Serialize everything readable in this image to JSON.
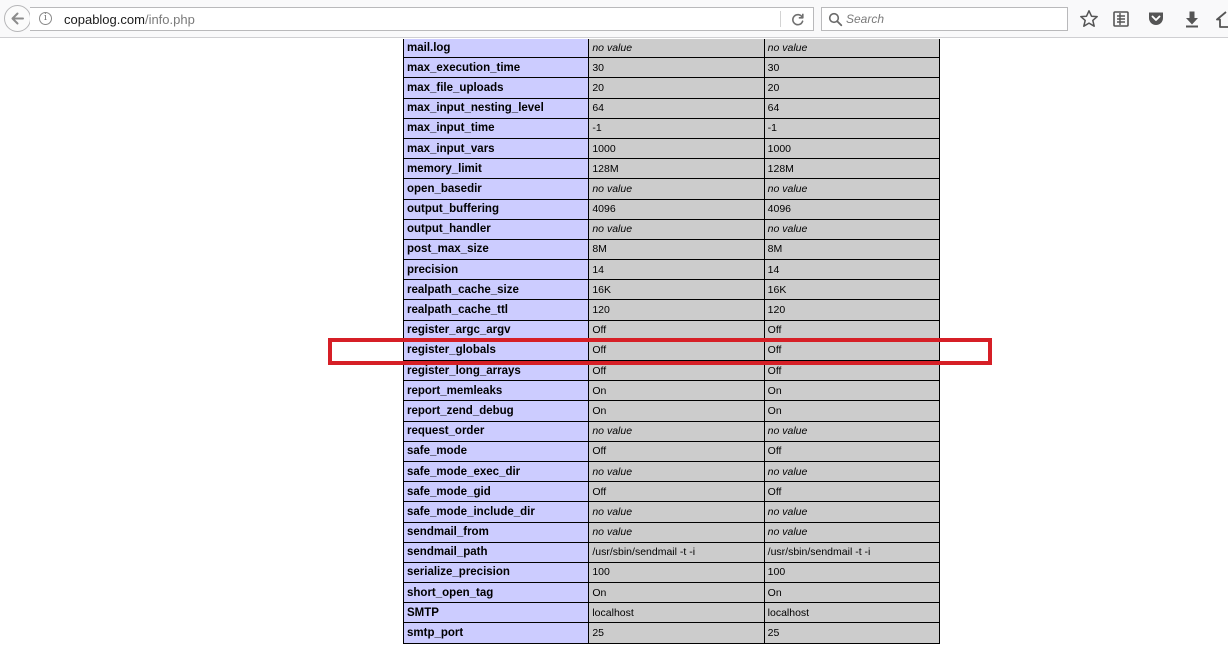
{
  "browser": {
    "url_domain": "copablog.com",
    "url_path": "/info.php",
    "search_placeholder": "Search"
  },
  "accent": {
    "highlight_border": "#d61f26"
  },
  "table": {
    "rows": [
      {
        "directive": "mail.log",
        "local": "no value",
        "master": "no value"
      },
      {
        "directive": "max_execution_time",
        "local": "30",
        "master": "30"
      },
      {
        "directive": "max_file_uploads",
        "local": "20",
        "master": "20"
      },
      {
        "directive": "max_input_nesting_level",
        "local": "64",
        "master": "64"
      },
      {
        "directive": "max_input_time",
        "local": "-1",
        "master": "-1"
      },
      {
        "directive": "max_input_vars",
        "local": "1000",
        "master": "1000"
      },
      {
        "directive": "memory_limit",
        "local": "128M",
        "master": "128M"
      },
      {
        "directive": "open_basedir",
        "local": "no value",
        "master": "no value"
      },
      {
        "directive": "output_buffering",
        "local": "4096",
        "master": "4096"
      },
      {
        "directive": "output_handler",
        "local": "no value",
        "master": "no value"
      },
      {
        "directive": "post_max_size",
        "local": "8M",
        "master": "8M"
      },
      {
        "directive": "precision",
        "local": "14",
        "master": "14"
      },
      {
        "directive": "realpath_cache_size",
        "local": "16K",
        "master": "16K"
      },
      {
        "directive": "realpath_cache_ttl",
        "local": "120",
        "master": "120"
      },
      {
        "directive": "register_argc_argv",
        "local": "Off",
        "master": "Off"
      },
      {
        "directive": "register_globals",
        "local": "Off",
        "master": "Off"
      },
      {
        "directive": "register_long_arrays",
        "local": "Off",
        "master": "Off"
      },
      {
        "directive": "report_memleaks",
        "local": "On",
        "master": "On"
      },
      {
        "directive": "report_zend_debug",
        "local": "On",
        "master": "On"
      },
      {
        "directive": "request_order",
        "local": "no value",
        "master": "no value"
      },
      {
        "directive": "safe_mode",
        "local": "Off",
        "master": "Off"
      },
      {
        "directive": "safe_mode_exec_dir",
        "local": "no value",
        "master": "no value"
      },
      {
        "directive": "safe_mode_gid",
        "local": "Off",
        "master": "Off"
      },
      {
        "directive": "safe_mode_include_dir",
        "local": "no value",
        "master": "no value"
      },
      {
        "directive": "sendmail_from",
        "local": "no value",
        "master": "no value"
      },
      {
        "directive": "sendmail_path",
        "local": "/usr/sbin/sendmail -t -i",
        "master": "/usr/sbin/sendmail -t -i"
      },
      {
        "directive": "serialize_precision",
        "local": "100",
        "master": "100"
      },
      {
        "directive": "short_open_tag",
        "local": "On",
        "master": "On"
      },
      {
        "directive": "SMTP",
        "local": "localhost",
        "master": "localhost"
      },
      {
        "directive": "smtp_port",
        "local": "25",
        "master": "25"
      }
    ]
  }
}
